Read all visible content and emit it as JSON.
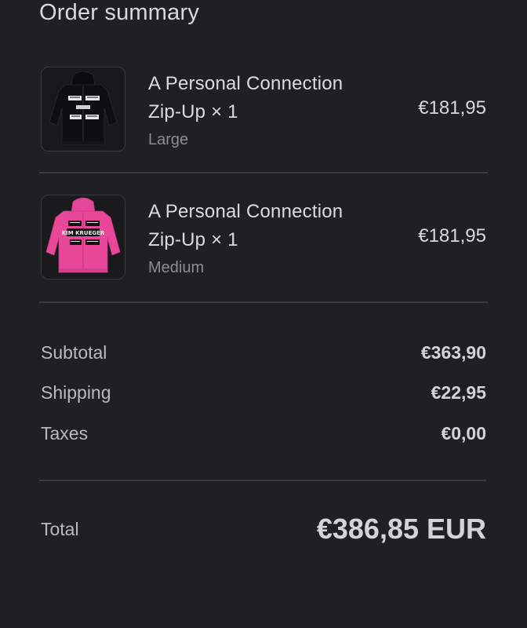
{
  "header": {
    "title": "Order summary"
  },
  "items": [
    {
      "name_line1": "A Personal Connection",
      "name_line2": "Zip-Up × 1",
      "variant": "Large",
      "price": "€181,95",
      "thumbnail_icon": "black-hoodie-image",
      "hoodie_color": "#111113"
    },
    {
      "name_line1": "A Personal Connection",
      "name_line2": "Zip-Up × 1",
      "variant": "Medium",
      "price": "€181,95",
      "thumbnail_icon": "pink-hoodie-image",
      "hoodie_color": "#e8479a",
      "print_text": "KIM KRUEGER"
    }
  ],
  "summary": {
    "subtotal_label": "Subtotal",
    "subtotal_value": "€363,90",
    "shipping_label": "Shipping",
    "shipping_value": "€22,95",
    "taxes_label": "Taxes",
    "taxes_value": "€0,00"
  },
  "total": {
    "label": "Total",
    "value": "€386,85 EUR"
  },
  "colors": {
    "background": "#1f2023",
    "divider": "#3a3b3f",
    "text_primary": "#dcdcdf",
    "text_muted": "#8c8d92"
  }
}
